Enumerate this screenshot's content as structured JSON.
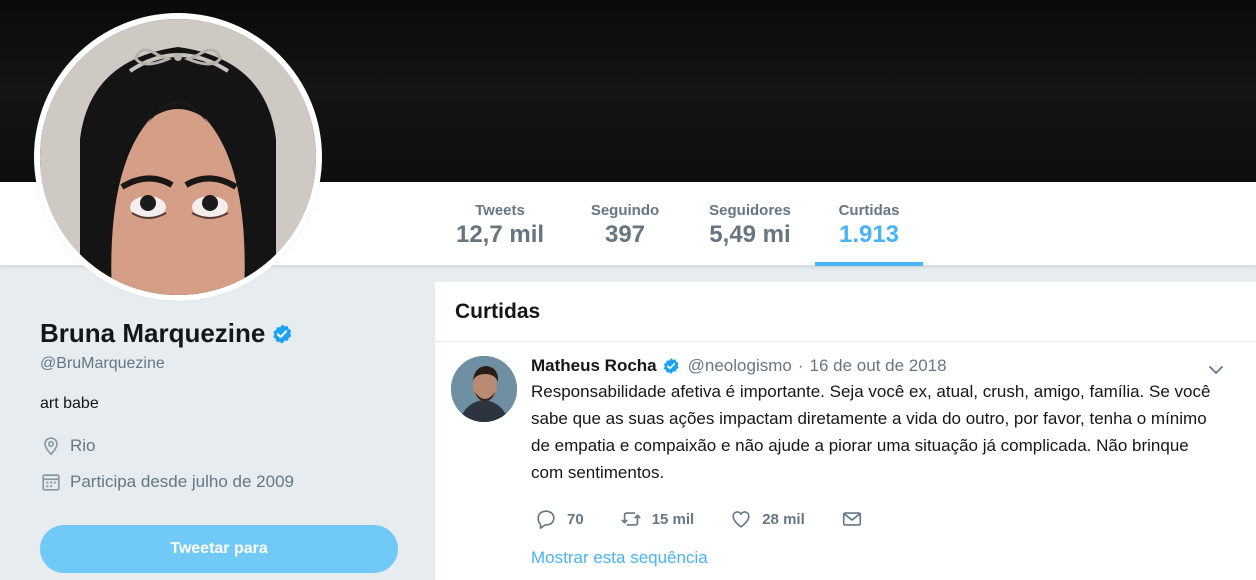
{
  "nav": {
    "stats": [
      {
        "label": "Tweets",
        "value": "12,7 mil"
      },
      {
        "label": "Seguindo",
        "value": "397"
      },
      {
        "label": "Seguidores",
        "value": "5,49 mi"
      },
      {
        "label": "Curtidas",
        "value": "1.913"
      }
    ],
    "active_tab": "Curtidas"
  },
  "profile": {
    "name": "Bruna Marquezine",
    "handle": "@BruMarquezine",
    "bio": "art babe",
    "location": "Rio",
    "joined": "Participa desde julho de 2009",
    "tweet_to_button": "Tweetar para"
  },
  "timeline": {
    "title": "Curtidas",
    "tweet": {
      "author_name": "Matheus Rocha",
      "author_handle": "@neologismo",
      "separator": "·",
      "date": "16 de out de 2018",
      "text": "Responsabilidade afetiva é importante. Seja você ex, atual, crush, amigo, família. Se você sabe que as suas ações impactam diretamente a vida do outro, por favor, tenha o mínimo de empatia e compaixão e não ajude a piorar uma situação já complicada. Não brinque com sentimentos.",
      "reply_count": "70",
      "retweet_count": "15 mil",
      "like_count": "28 mil",
      "show_thread": "Mostrar esta sequência"
    }
  },
  "colors": {
    "accent": "#4ab3f4",
    "verified": "#1da1f2",
    "muted": "#657786",
    "button": "#71c9f8"
  }
}
